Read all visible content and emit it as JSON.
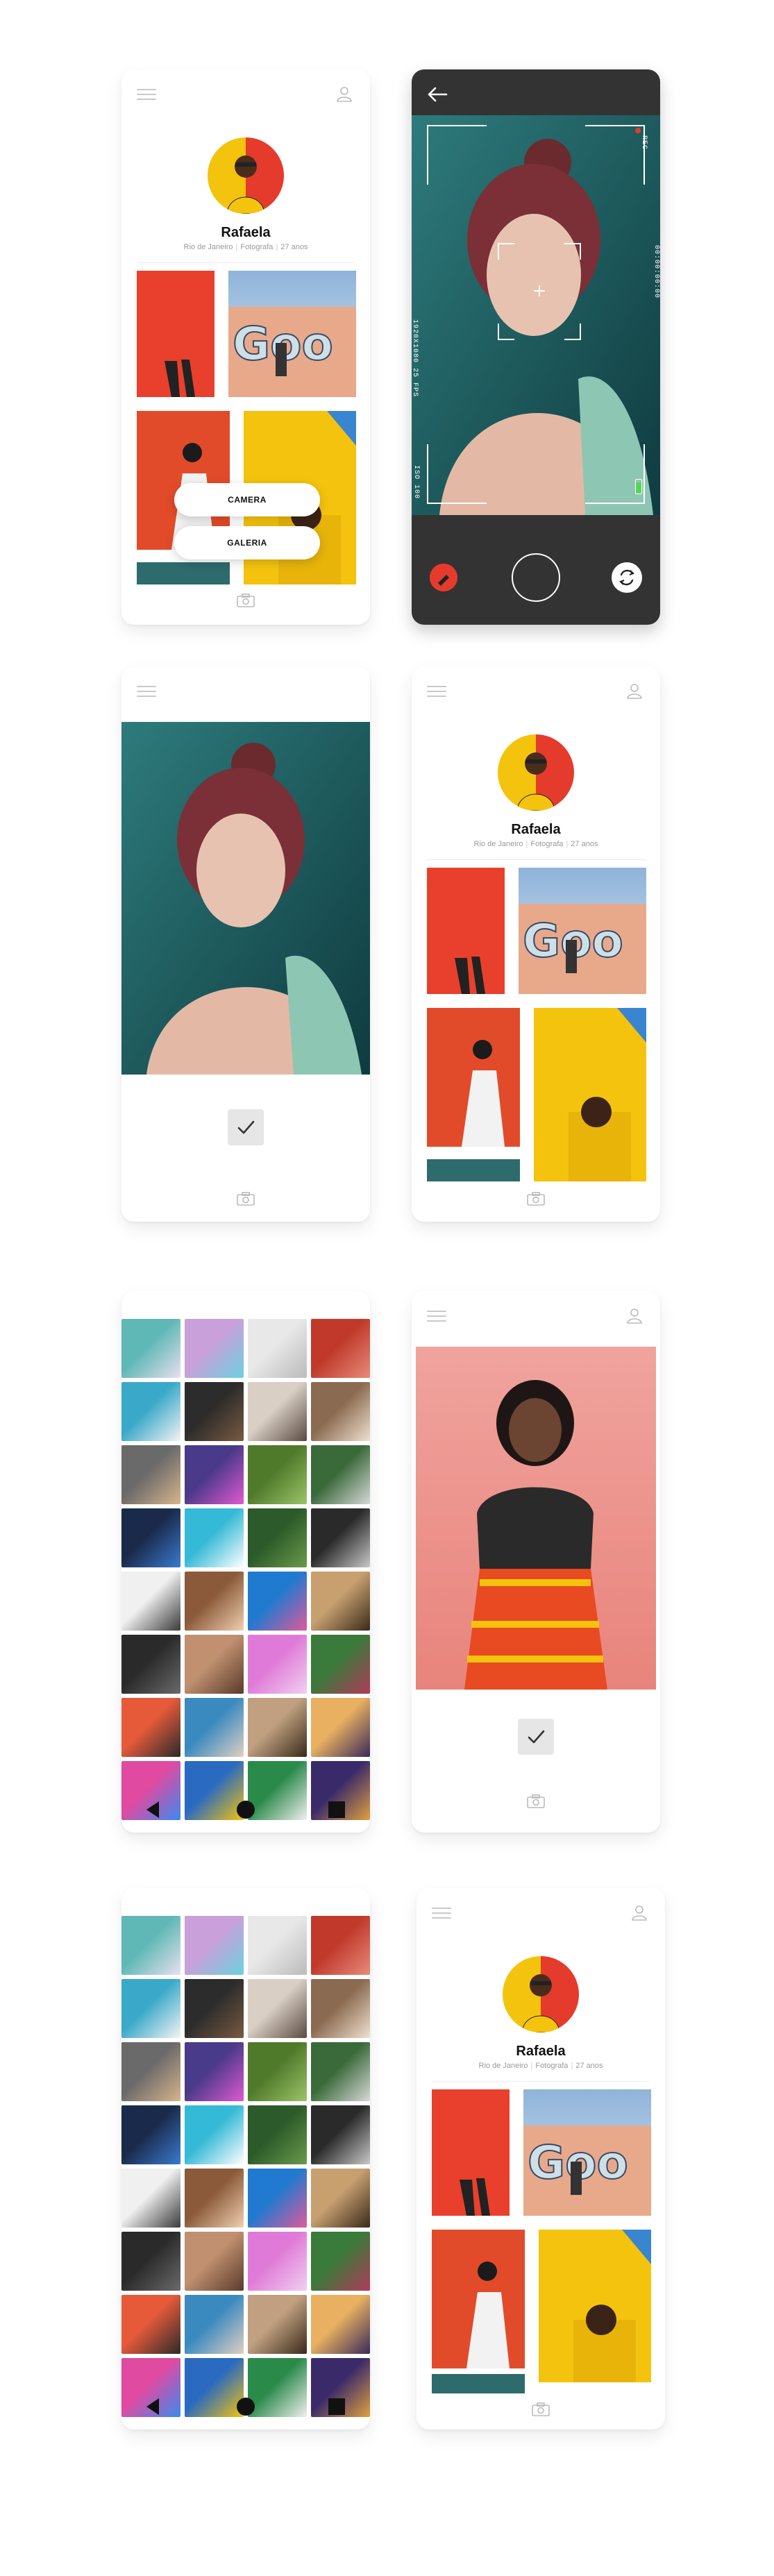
{
  "profile": {
    "name": "Rafaela",
    "location": "Rio de Janeiro",
    "profession": "Fotografa",
    "age": "27 anos"
  },
  "picker": {
    "camera_label": "CAMERA",
    "gallery_label": "GALERIA"
  },
  "camera": {
    "rec_label": "REC",
    "resolution_left": "1920X1080 25 FPS",
    "timecode_right": "00:00:00:00",
    "battery": "96%",
    "iso": "ISO 100"
  },
  "colors": {
    "accent_red": "#e53b2c",
    "accent_yellow": "#f4c30d",
    "dark_panel": "#333333",
    "teal_bg": "#1f5a5c"
  },
  "icons": [
    "menu-icon",
    "user-icon",
    "camera-icon",
    "back-arrow-icon",
    "shutter-button",
    "switch-camera-icon",
    "check-icon"
  ]
}
